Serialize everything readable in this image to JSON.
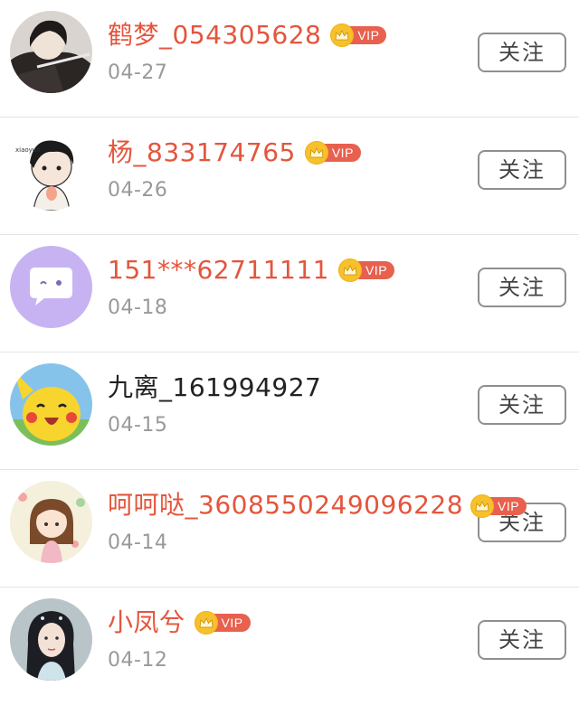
{
  "follow_label": "关注",
  "vip_label": "VIP",
  "colors": {
    "vip_name": "#e4553d",
    "plain_name": "#222222",
    "date": "#999999",
    "badge": "#e8604e",
    "crown": "#f7c12b"
  },
  "users": [
    {
      "name": "鹤梦_054305628",
      "date": "04-27",
      "vip": true,
      "avatar": "anime-swordsman-avatar"
    },
    {
      "name": "杨_833174765",
      "date": "04-26",
      "vip": true,
      "avatar": "cartoon-boy-avatar"
    },
    {
      "name": "151***62711111",
      "date": "04-18",
      "vip": true,
      "avatar": "chat-bubble-avatar"
    },
    {
      "name": "九离_161994927",
      "date": "04-15",
      "vip": false,
      "avatar": "pikachu-avatar"
    },
    {
      "name": "呵呵哒_3608550249096228",
      "date": "04-14",
      "vip": true,
      "avatar": "cartoon-girl-avatar"
    },
    {
      "name": "小凤兮",
      "date": "04-12",
      "vip": true,
      "avatar": "woman-portrait-avatar"
    }
  ]
}
